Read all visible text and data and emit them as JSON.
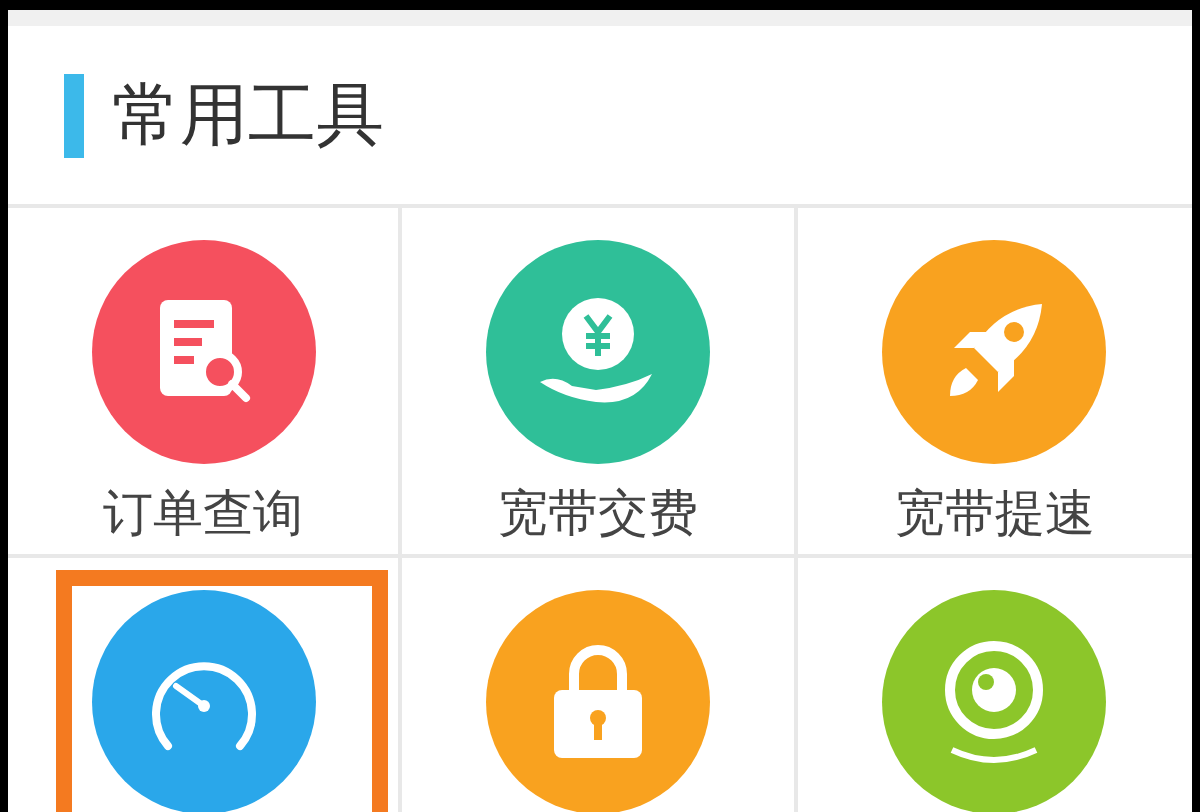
{
  "section": {
    "title": "常用工具"
  },
  "tiles": [
    {
      "kind": "order",
      "color": "#f5505e",
      "label": "订单查询",
      "highlighted": false
    },
    {
      "kind": "payment",
      "color": "#2fbf98",
      "label": "宽带交费",
      "highlighted": false
    },
    {
      "kind": "rocket",
      "color": "#f9a21f",
      "label": "宽带提速",
      "highlighted": false
    },
    {
      "kind": "speedometer",
      "color": "#2aa7ea",
      "highlighted": true
    },
    {
      "kind": "lock",
      "color": "#f9a21f",
      "highlighted": false
    },
    {
      "kind": "camera",
      "color": "#8cc62a",
      "highlighted": false
    }
  ]
}
